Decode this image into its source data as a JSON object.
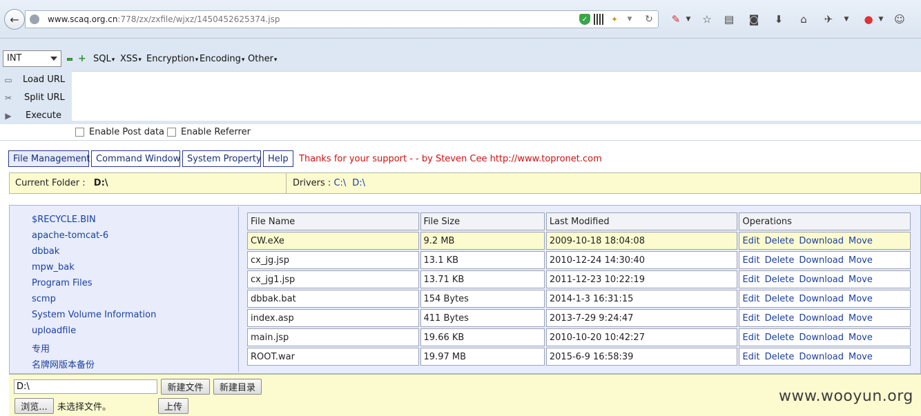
{
  "browser": {
    "url_prefix": "www.scaq.org.cn",
    "url_rest": ":778/zx/zxfile/wjxz/1450452625374.jsp",
    "icons": [
      "back-icon",
      "globe-icon",
      "shield-icon",
      "qr-icon",
      "extension-icon",
      "dropdown-icon",
      "reload-icon",
      "search-engine-icon",
      "star-icon",
      "reading-list-icon",
      "pocket-icon",
      "download-icon",
      "home-icon",
      "addon-icon",
      "overflow-icon",
      "profile-icon",
      "emoji-icon"
    ]
  },
  "hackbar": {
    "select_value": "INT",
    "menus": [
      "SQL",
      "XSS",
      "Encryption",
      "Encoding",
      "Other"
    ],
    "load_url": "Load URL",
    "split_url": "Split URL",
    "execute": "Execute",
    "enable_post": "Enable Post data",
    "enable_referrer": "Enable Referrer"
  },
  "tabs": [
    "File Management",
    "Command Window",
    "System Property",
    "Help"
  ],
  "thanks": "Thanks for your support - - by Steven Cee http://www.topronet.com",
  "folder": {
    "label": "Current Folder :",
    "value": "D:\\",
    "drivers_label": "Drivers :",
    "drivers": [
      "C:\\",
      "D:\\"
    ]
  },
  "dirs": [
    "$RECYCLE.BIN",
    "apache-tomcat-6",
    "dbbak",
    "mpw_bak",
    "Program Files",
    "scmp",
    "System Volume Information",
    "uploadfile",
    "专用",
    "名牌网版本备份"
  ],
  "table": {
    "headers": [
      "File Name",
      "File Size",
      "Last Modified",
      "Operations"
    ],
    "operations": [
      "Edit",
      "Delete",
      "Download",
      "Move"
    ],
    "rows": [
      {
        "name": "CW.eXe",
        "size": "9.2 MB",
        "modified": "2009-10-18 18:04:08"
      },
      {
        "name": "cx_jg.jsp",
        "size": "13.1 KB",
        "modified": "2010-12-24 14:30:40"
      },
      {
        "name": "cx_jg1.jsp",
        "size": "13.71 KB",
        "modified": "2011-12-23 10:22:19"
      },
      {
        "name": "dbbak.bat",
        "size": "154 Bytes",
        "modified": "2014-1-3 16:31:15"
      },
      {
        "name": "index.asp",
        "size": "411 Bytes",
        "modified": "2013-7-29 9:24:47"
      },
      {
        "name": "main.jsp",
        "size": "19.66 KB",
        "modified": "2010-10-20 10:42:27"
      },
      {
        "name": "ROOT.war",
        "size": "19.97 MB",
        "modified": "2015-6-9 16:58:39"
      }
    ]
  },
  "bottom": {
    "path_value": "D:\\",
    "new_file": "新建文件",
    "new_dir": "新建目录",
    "browse": "浏览...",
    "no_file": "未选择文件。",
    "upload": "上传"
  },
  "watermark": "www.wooyun.org"
}
